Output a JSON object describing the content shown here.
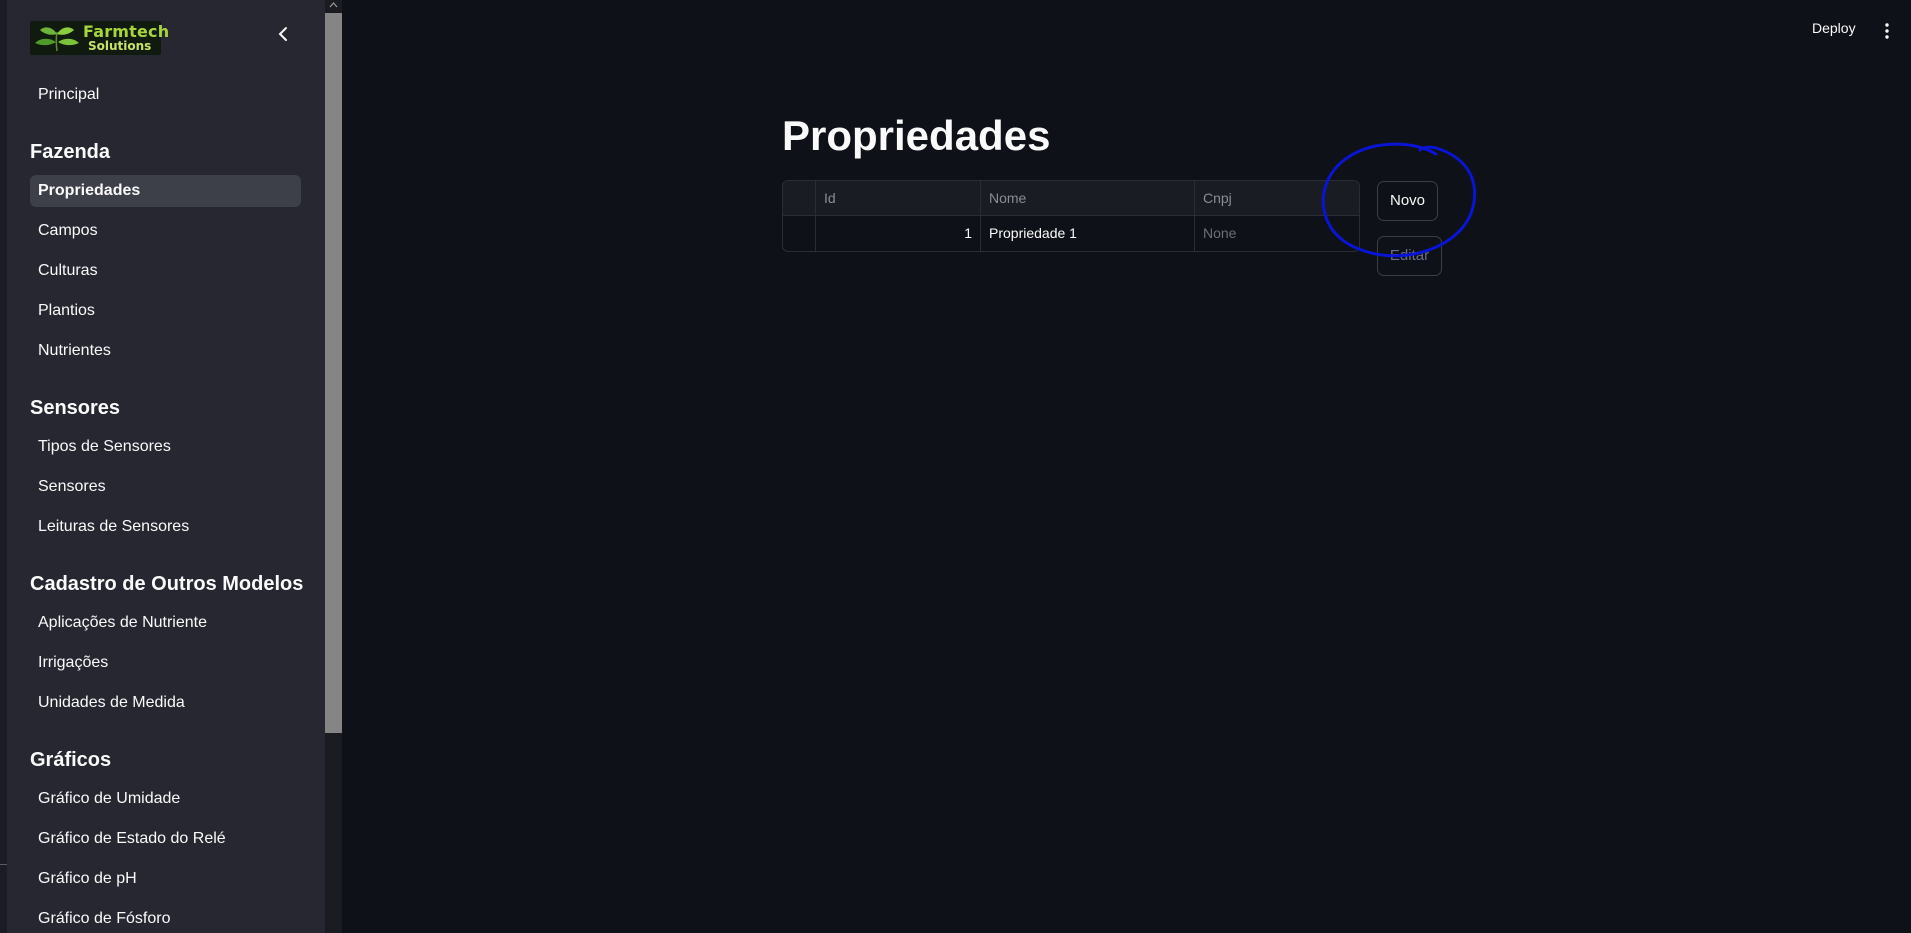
{
  "sidebar": {
    "logo": {
      "line1": "Farmtech",
      "line2": "Solutions"
    },
    "items_top": [
      {
        "label": "Principal"
      }
    ],
    "sections": [
      {
        "title": "Fazenda",
        "items": [
          {
            "label": "Propriedades",
            "active": true
          },
          {
            "label": "Campos"
          },
          {
            "label": "Culturas"
          },
          {
            "label": "Plantios"
          },
          {
            "label": "Nutrientes"
          }
        ]
      },
      {
        "title": "Sensores",
        "items": [
          {
            "label": "Tipos de Sensores"
          },
          {
            "label": "Sensores"
          },
          {
            "label": "Leituras de Sensores"
          }
        ]
      },
      {
        "title": "Cadastro de Outros Modelos",
        "items": [
          {
            "label": "Aplicações de Nutriente"
          },
          {
            "label": "Irrigações"
          },
          {
            "label": "Unidades de Medida"
          }
        ]
      },
      {
        "title": "Gráficos",
        "items": [
          {
            "label": "Gráfico de Umidade"
          },
          {
            "label": "Gráfico de Estado do Relé"
          },
          {
            "label": "Gráfico de pH"
          },
          {
            "label": "Gráfico de Fósforo"
          }
        ]
      }
    ]
  },
  "header": {
    "deploy_label": "Deploy"
  },
  "main": {
    "title": "Propriedades",
    "table": {
      "columns": [
        "Id",
        "Nome",
        "Cnpj"
      ],
      "rows": [
        [
          "1",
          "Propriedade 1",
          "None"
        ]
      ]
    },
    "buttons": {
      "new_label": "Novo",
      "edit_label": "Editar"
    }
  },
  "colors": {
    "background": "#0e1117",
    "sidebar": "#262730",
    "annotation": "#0a14d4",
    "active_item": "#3d3f49"
  },
  "icons": [
    "chevron-left-icon",
    "kebab-menu-icon",
    "leaf-logo-icon",
    "scroll-up-arrow-icon"
  ]
}
